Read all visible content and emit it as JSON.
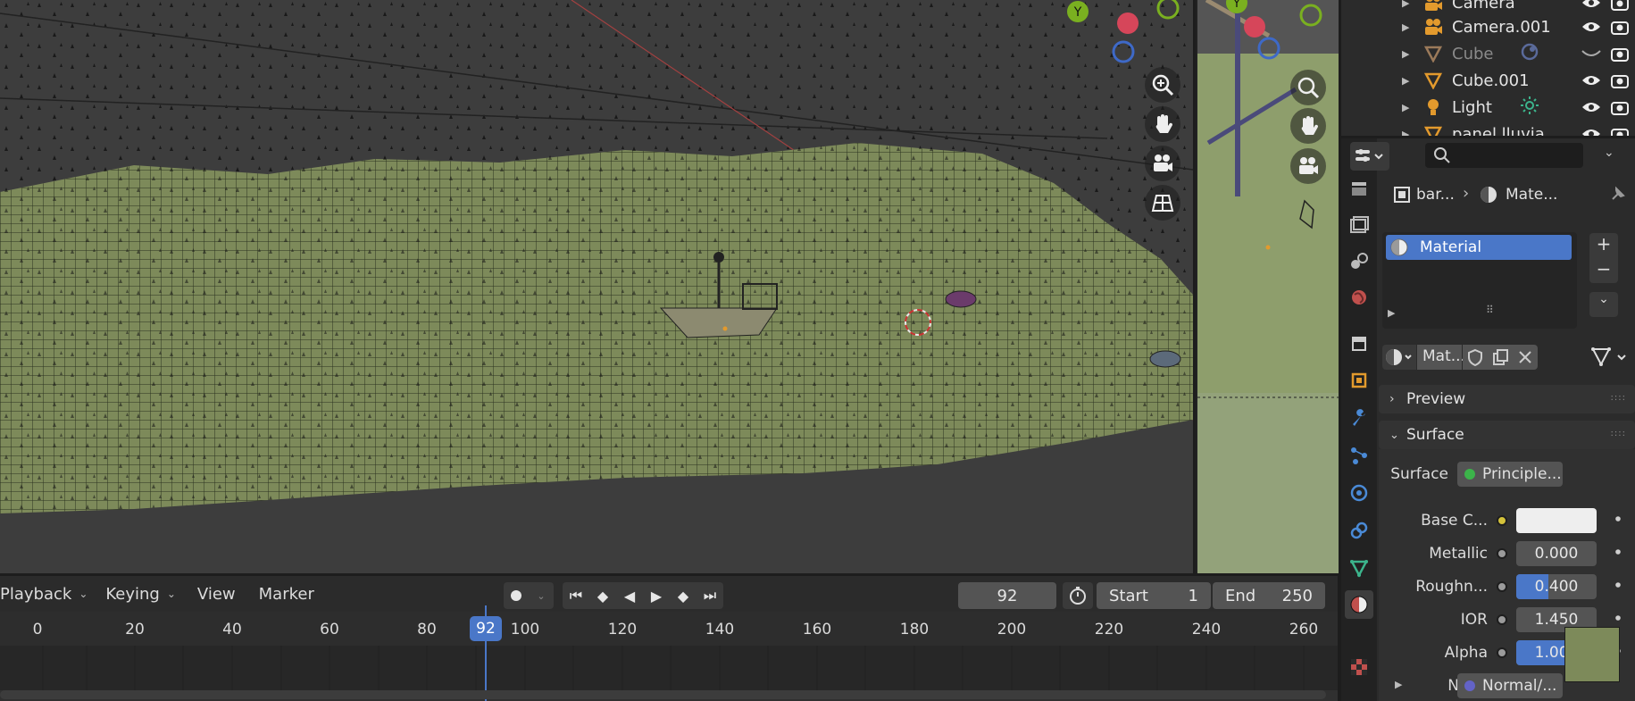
{
  "timeline": {
    "menus": [
      "Playback",
      "Keying",
      "View",
      "Marker"
    ],
    "current_frame": "92",
    "start_label": "Start",
    "start_value": "1",
    "end_label": "End",
    "end_value": "250",
    "ruler_ticks": [
      "0",
      "20",
      "40",
      "60",
      "80",
      "100",
      "120",
      "140",
      "160",
      "180",
      "200",
      "220",
      "240",
      "260"
    ],
    "playhead_badge": "92"
  },
  "outliner": {
    "items": [
      {
        "name": "Camera",
        "icon": "camera-icon",
        "dim": false
      },
      {
        "name": "Camera.001",
        "icon": "camera-icon",
        "dim": false
      },
      {
        "name": "Cube",
        "icon": "mesh-icon",
        "dim": true
      },
      {
        "name": "Cube.001",
        "icon": "mesh-icon",
        "dim": false
      },
      {
        "name": "Light",
        "icon": "light-icon",
        "dim": false
      },
      {
        "name": "panel lluvia",
        "icon": "mesh-icon",
        "dim": false
      }
    ]
  },
  "properties": {
    "breadcrumb_object": "bar...",
    "breadcrumb_material": "Mate...",
    "material_slot": "Material",
    "material_datablock": "Mat...",
    "panels": {
      "preview": "Preview",
      "surface": "Surface"
    },
    "surface": {
      "label": "Surface",
      "value": "Principle..."
    },
    "rows": [
      {
        "label": "Base C...",
        "value": "",
        "kind": "color",
        "dot": "#d4c23a"
      },
      {
        "label": "Metallic",
        "value": "0.000",
        "kind": "number",
        "fill": 0
      },
      {
        "label": "Roughn...",
        "value": "0.400",
        "kind": "number",
        "fill": 0.4
      },
      {
        "label": "IOR",
        "value": "1.450",
        "kind": "number",
        "fill": 0
      },
      {
        "label": "Alpha",
        "value": "1.000",
        "kind": "number",
        "fill": 1
      }
    ],
    "normal": {
      "label": "Nor...",
      "value": "Normal/..."
    }
  },
  "colors": {
    "accent": "#4a77c8",
    "terrain": "#7d8a5a",
    "bg": "#2b2b2b"
  }
}
